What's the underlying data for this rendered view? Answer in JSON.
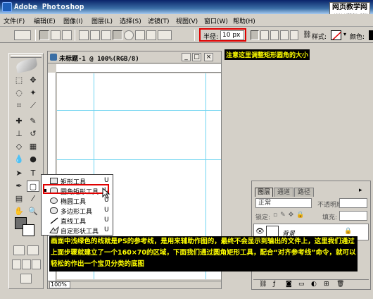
{
  "window": {
    "title": "Adobe Photoshop"
  },
  "watermark": {
    "site": "网页教学网",
    "url": "WWW.WEBJX.COM"
  },
  "menu": [
    "文件(F)",
    "编辑(E)",
    "图像(I)",
    "图层(L)",
    "选择(S)",
    "滤镜(T)",
    "视图(V)",
    "窗口(W)",
    "帮助(H)"
  ],
  "options": {
    "radius_label": "半径:",
    "radius_value": "10 px",
    "style_label": "样式:",
    "color_label": "颜色:"
  },
  "document": {
    "title": "未标题-1 @ 100%(RGB/8)",
    "zoom": "100%"
  },
  "flyout": {
    "items": [
      {
        "label": "矩形工具",
        "key": "U",
        "icon": "rectangle-icon",
        "selected": false
      },
      {
        "label": "圆角矩形工具",
        "key": "U",
        "icon": "rounded-rectangle-icon",
        "selected": true
      },
      {
        "label": "椭圆工具",
        "key": "U",
        "icon": "ellipse-icon",
        "selected": false
      },
      {
        "label": "多边形工具",
        "key": "U",
        "icon": "polygon-icon",
        "selected": false
      },
      {
        "label": "直线工具",
        "key": "U",
        "icon": "line-icon",
        "selected": false
      },
      {
        "label": "自定形状工具",
        "key": "U",
        "icon": "custom-shape-icon",
        "selected": false
      }
    ]
  },
  "layers": {
    "tabs": [
      "图层",
      "通道",
      "路径"
    ],
    "blend_mode": "正常",
    "opacity_label": "不透明度:",
    "lock_label": "锁定:",
    "fill_label": "填充:",
    "layer_name": "背景"
  },
  "annotations": {
    "radius_note": "注意这里调整矩形圆角的大小",
    "guides_note": "画面中浅绿色的线就是PS的参考线，是用来辅助作图的，最终不会显示到输出的文件上，这里我们通过上面步骤就建立了一个160×70的区域，下面我们通过圆角矩形工具，配合“对齐参考线”命令，就可以轻松的作出一个宝贝分类的底图"
  },
  "colors": {
    "highlight_border": "#e00000",
    "annotation_text": "#ffff00",
    "guide_line": "#6ed4f0",
    "foreground_color": "#6d6d6d"
  }
}
